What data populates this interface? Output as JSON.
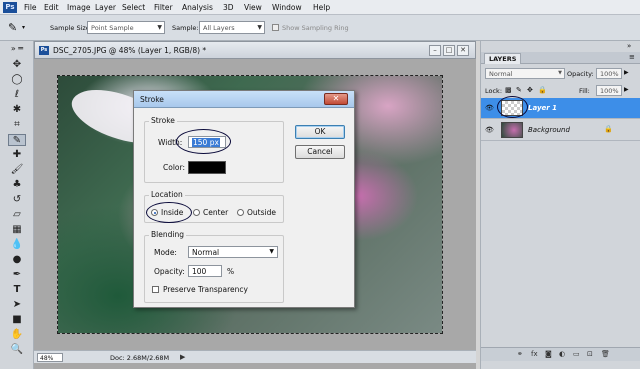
{
  "menu": [
    "File",
    "Edit",
    "Image",
    "Layer",
    "Select",
    "Filter",
    "Analysis",
    "3D",
    "View",
    "Window",
    "Help"
  ],
  "app_logo": "Ps",
  "options": {
    "sample_size_label": "Sample Size:",
    "sample_size_value": "Point Sample",
    "sample_label": "Sample:",
    "sample_value": "All Layers",
    "show_ring_label": "Show Sampling Ring"
  },
  "tools": [
    "move-tool",
    "marquee-tool",
    "lasso-tool",
    "quick-select-tool",
    "crop-tool",
    "eyedropper-tool",
    "healing-tool",
    "brush-tool",
    "clone-stamp-tool",
    "history-brush-tool",
    "eraser-tool",
    "gradient-tool",
    "blur-tool",
    "dodge-tool",
    "pen-tool",
    "type-tool",
    "path-select-tool",
    "shape-tool",
    "hand-tool",
    "zoom-tool"
  ],
  "document": {
    "title": "DSC_2705.JPG @ 48% (Layer 1, RGB/8) *",
    "zoom": "48%",
    "doc_info": "Doc: 2.68M/2.68M"
  },
  "dialog": {
    "title": "Stroke",
    "stroke_group": "Stroke",
    "width_label": "Width:",
    "width_value": "150 px",
    "color_label": "Color:",
    "stroke_color": "#000000",
    "location_group": "Location",
    "location_options": [
      "Inside",
      "Center",
      "Outside"
    ],
    "location_selected": "Inside",
    "blending_group": "Blending",
    "mode_label": "Mode:",
    "mode_value": "Normal",
    "opacity_label": "Opacity:",
    "opacity_value": "100",
    "opacity_unit": "%",
    "preserve_label": "Preserve Transparency",
    "preserve_checked": false,
    "ok_label": "OK",
    "cancel_label": "Cancel"
  },
  "layers": {
    "tab": "LAYERS",
    "blend_mode": "Normal",
    "opacity_label": "Opacity:",
    "opacity_value": "100%",
    "lock_label": "Lock:",
    "fill_label": "Fill:",
    "fill_value": "100%",
    "rows": [
      {
        "name": "Layer 1",
        "selected": true
      },
      {
        "name": "Background",
        "selected": false,
        "locked": true
      }
    ]
  },
  "colors": {
    "selection_blue": "#3d8ee8",
    "title_bar": "#a8c8ec",
    "annotation_ellipse": "#0a0a3a"
  }
}
